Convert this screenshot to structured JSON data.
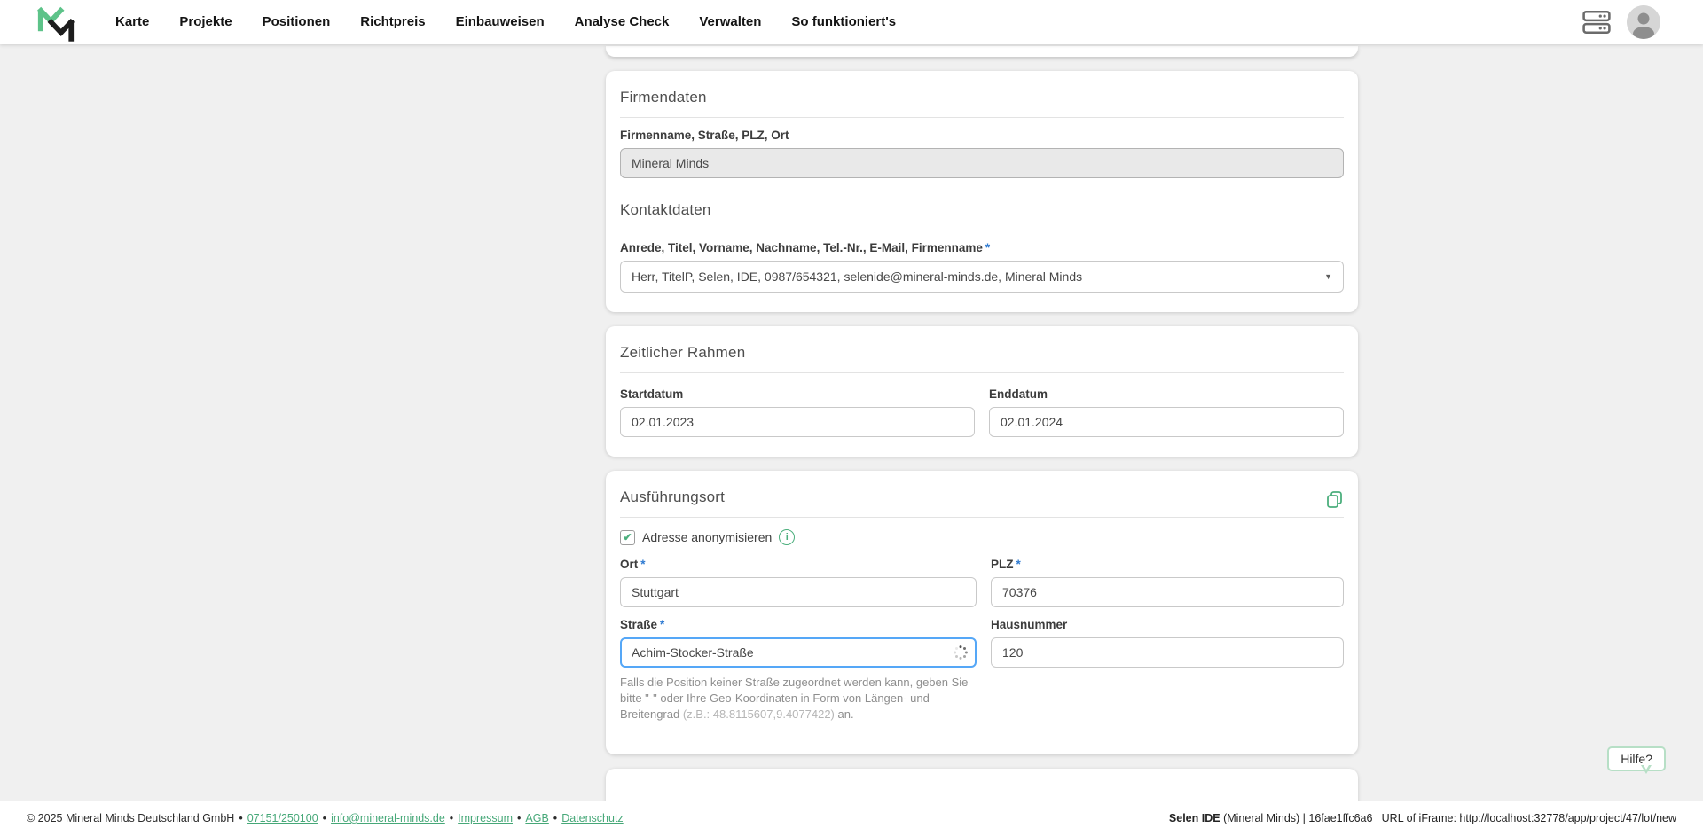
{
  "nav": {
    "items": [
      "Karte",
      "Projekte",
      "Positionen",
      "Richtpreis",
      "Einbauweisen",
      "Analyse Check",
      "Verwalten",
      "So funktioniert's"
    ]
  },
  "company": {
    "heading": "Firmendaten",
    "field_label": "Firmenname, Straße, PLZ, Ort",
    "field_value": "Mineral Minds"
  },
  "contact": {
    "heading": "Kontaktdaten",
    "field_label": "Anrede, Titel, Vorname, Nachname, Tel.-Nr., E-Mail, Firmenname",
    "required_mark": "*",
    "selected_value": "Herr, TitelP, Selen, IDE, 0987/654321, selenide@mineral-minds.de, Mineral Minds",
    "dropdown_arrow": "▼"
  },
  "timeframe": {
    "heading": "Zeitlicher Rahmen",
    "start_label": "Startdatum",
    "start_value": "02.01.2023",
    "end_label": "Enddatum",
    "end_value": "02.01.2024"
  },
  "location": {
    "heading": "Ausführungsort",
    "anonymize_label": "Adresse anonymisieren",
    "checkbox_glyph": "✔",
    "info_glyph": "i",
    "required_mark": "*",
    "ort_label": "Ort",
    "ort_value": "Stuttgart",
    "plz_label": "PLZ",
    "plz_value": "70376",
    "strasse_label": "Straße",
    "strasse_value": "Achim-Stocker-Straße",
    "hausnummer_label": "Hausnummer",
    "hausnummer_value": "120",
    "helper_text_1": "Falls die Position keiner Straße zugeordnet werden kann, geben Sie bitte \"-\" oder Ihre Geo-Koordinaten in Form von Längen- und Breitengrad ",
    "helper_coords": "(z.B.: 48.8115607,9.4077422)",
    "helper_text_2": " an."
  },
  "help": {
    "label": "Hilfe?"
  },
  "footer": {
    "copyright": "© 2025 Mineral Minds Deutschland GmbH",
    "separator": "•",
    "links": [
      "07151/250100",
      "info@mineral-minds.de",
      "Impressum",
      "AGB",
      "Datenschutz"
    ],
    "right_app": "Selen IDE",
    "right_rest": " (Mineral Minds) | 16fae1ffc6a6 | URL of iFrame: http://localhost:32778/app/project/47/lot/new"
  },
  "colors": {
    "accent_green": "#4caf7d",
    "logo_green": "#5dc389",
    "focus_blue": "#55a7f7",
    "required_blue": "#2e7ad1",
    "link_green": "#46a878"
  }
}
